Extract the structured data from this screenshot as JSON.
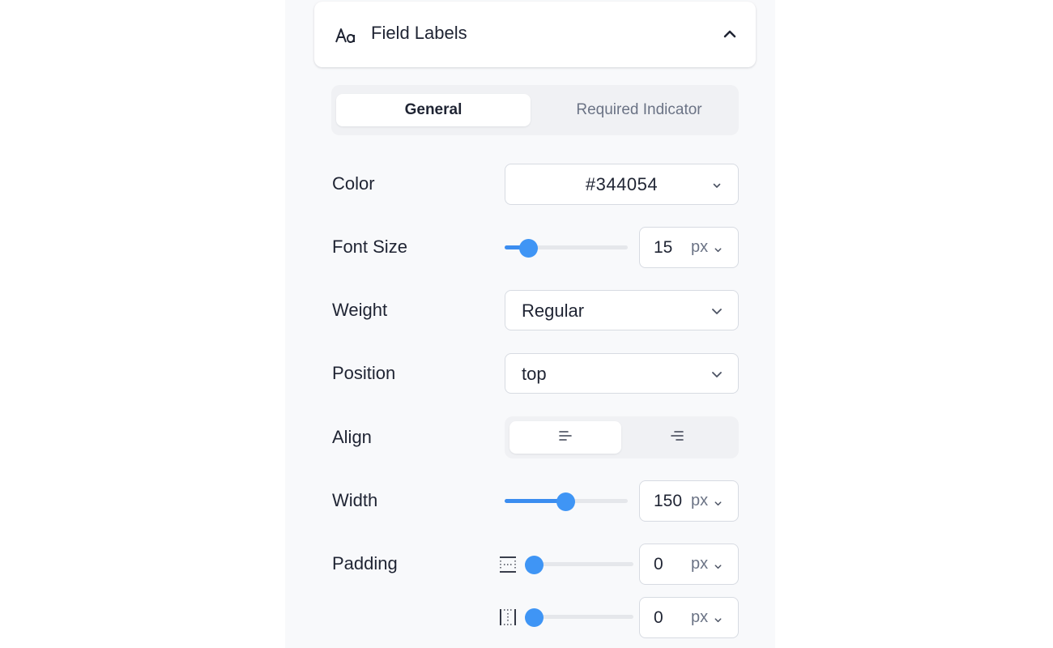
{
  "section": {
    "title": "Field Labels",
    "icon": "font-type-icon",
    "collapse_icon": "chevron-up-icon"
  },
  "tabs": [
    {
      "label": "General",
      "active": true
    },
    {
      "label": "Required Indicator",
      "active": false
    }
  ],
  "fields": {
    "color": {
      "label": "Color",
      "value": "#344054"
    },
    "font_size": {
      "label": "Font Size",
      "value": "15",
      "unit": "px",
      "slider_fraction": 0.19
    },
    "weight": {
      "label": "Weight",
      "value": "Regular"
    },
    "position": {
      "label": "Position",
      "value": "top"
    },
    "align": {
      "label": "Align",
      "options": [
        "align-left-icon",
        "align-right-icon"
      ],
      "selected": "align-left-icon"
    },
    "width": {
      "label": "Width",
      "value": "150",
      "unit": "px",
      "slider_fraction": 0.49
    },
    "padding": {
      "label": "Padding",
      "vertical": {
        "icon": "padding-vertical-icon",
        "value": "0",
        "unit": "px",
        "slider_fraction": 0.0
      },
      "horizontal": {
        "icon": "padding-horizontal-icon",
        "value": "0",
        "unit": "px",
        "slider_fraction": 0.0
      }
    }
  },
  "colors": {
    "accent": "#3f95f5",
    "text": "#1f2433",
    "muted": "#6b7385",
    "panel_bg": "#f8f9fb"
  }
}
